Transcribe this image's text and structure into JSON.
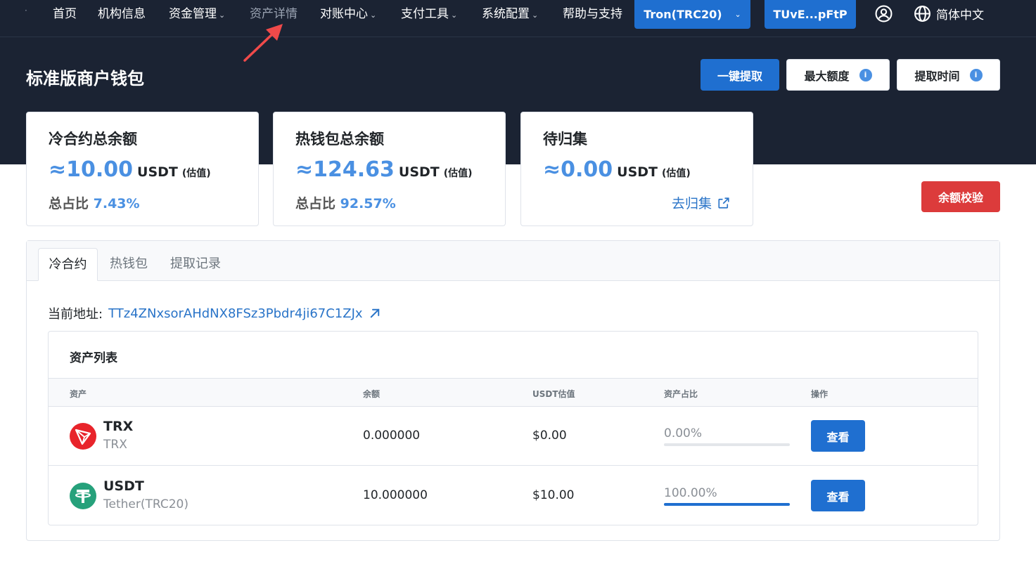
{
  "nav": {
    "dot": "·",
    "items": [
      {
        "label": "首页",
        "has_caret": false
      },
      {
        "label": "机构信息",
        "has_caret": false
      },
      {
        "label": "资金管理",
        "has_caret": true
      },
      {
        "label": "资产详情",
        "has_caret": false,
        "active": true
      },
      {
        "label": "对账中心",
        "has_caret": true
      },
      {
        "label": "支付工具",
        "has_caret": true
      },
      {
        "label": "系统配置",
        "has_caret": true
      },
      {
        "label": "帮助与支持",
        "has_caret": false
      }
    ],
    "caret": "⌄",
    "network_button": "Tron(TRC20)",
    "account_button": "TUvE...pFtP",
    "language": "简体中文"
  },
  "header": {
    "title": "标准版商户钱包",
    "one_click_withdraw": "一键提取",
    "max_limit": "最大额度",
    "withdraw_time": "提取时间",
    "info_glyph": "i"
  },
  "cards": [
    {
      "title": "冷合约总余额",
      "value": "≈10.00",
      "unit": "USDT",
      "est": "(估值)",
      "ratio_label": "总占比",
      "ratio": "7.43%"
    },
    {
      "title": "热钱包总余额",
      "value": "≈124.63",
      "unit": "USDT",
      "est": "(估值)",
      "ratio_label": "总占比",
      "ratio": "92.57%"
    },
    {
      "title": "待归集",
      "value": "≈0.00",
      "unit": "USDT",
      "est": "(估值)",
      "link": "去归集"
    }
  ],
  "verify_button": "余额校验",
  "tabs": [
    "冷合约",
    "热钱包",
    "提取记录"
  ],
  "address": {
    "label": "当前地址:",
    "value": "TTz4ZNxsorAHdNX8FSz3Pbdr4ji67C1ZJx"
  },
  "asset_list": {
    "title": "资产列表",
    "columns": [
      "资产",
      "余额",
      "USDT估值",
      "资产占比",
      "操作"
    ],
    "rows": [
      {
        "symbol": "TRX",
        "name": "TRX",
        "balance": "0.000000",
        "usdt": "$0.00",
        "ratio": "0.00%",
        "ratio_value": 0,
        "action": "查看",
        "icon_color": "#e8242b"
      },
      {
        "symbol": "USDT",
        "name": "Tether(TRC20)",
        "balance": "10.000000",
        "usdt": "$10.00",
        "ratio": "100.00%",
        "ratio_value": 100,
        "action": "查看",
        "icon_color": "#26a17b"
      }
    ]
  },
  "colors": {
    "dark_bg": "#1b2333",
    "primary": "#1f6fd0",
    "accent_blue": "#4a90e2",
    "danger": "#dc3b3b",
    "annotation_arrow": "#f04a4a"
  }
}
